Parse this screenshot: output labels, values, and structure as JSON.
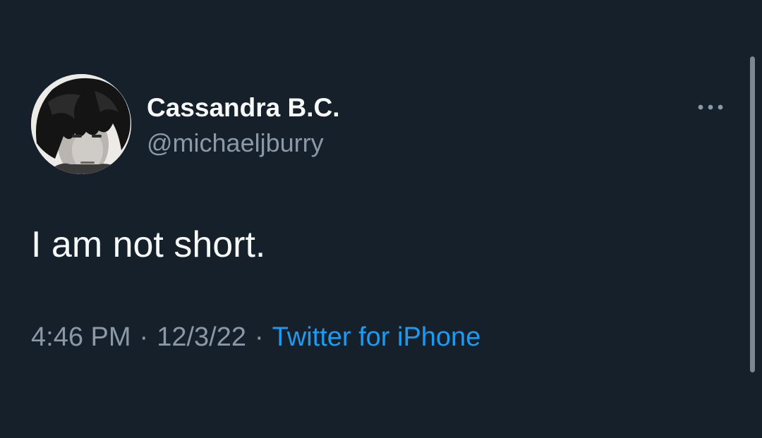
{
  "tweet": {
    "author": {
      "display_name": "Cassandra B.C.",
      "handle": "@michaeljburry",
      "avatar_icon": "profile-photo-avatar"
    },
    "text": "I am not short.",
    "time": "4:46 PM",
    "separator": "·",
    "date": "12/3/22",
    "source": "Twitter for iPhone",
    "more_icon": "more-options-icon"
  },
  "theme": {
    "background": "#15202b",
    "primary_text": "#f7f9f9",
    "secondary_text": "#8b98a5",
    "link": "#1d9bf0"
  }
}
